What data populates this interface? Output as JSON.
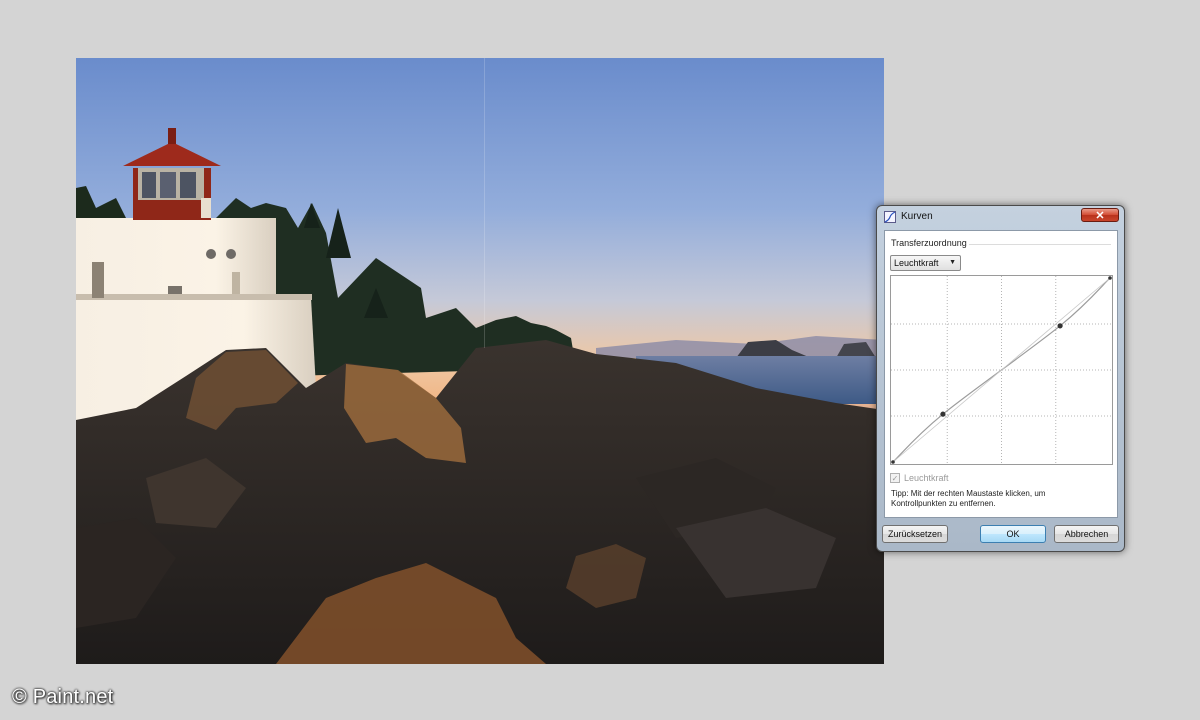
{
  "photo": {
    "subject": "lighthouse on rocky coast at sunset",
    "sky_top_color": "#6a8ccc",
    "sky_horizon_color": "#f1b889",
    "rock_color": "#2e2a27",
    "lighthouse_cap_color": "#9e2a1c"
  },
  "watermark": {
    "text": "© Paint.net"
  },
  "dialog": {
    "title": "Kurven",
    "title_icon": "curves-icon",
    "close_label": "✕",
    "section_label": "Transferzuordnung",
    "channel_select": {
      "selected": "Leuchtkraft",
      "arrow_icon": "chevron-down-icon"
    },
    "curve": {
      "grid_divisions": 4,
      "control_points": [
        {
          "input": 0,
          "output": 0
        },
        {
          "input": 0.23,
          "output": 0.26
        },
        {
          "input": 0.77,
          "output": 0.74
        },
        {
          "input": 1,
          "output": 1
        }
      ],
      "line_color": "#9c9c9c",
      "point_color": "#333333"
    },
    "luminosity_checkbox": {
      "label": "Leuchtkraft",
      "checked": true,
      "enabled": false
    },
    "tip": "Tipp: Mit der rechten Maustaste klicken, um Kontrollpunkten zu entfernen.",
    "buttons": {
      "reset": "Zurücksetzen",
      "ok": "OK",
      "cancel": "Abbrechen"
    }
  }
}
